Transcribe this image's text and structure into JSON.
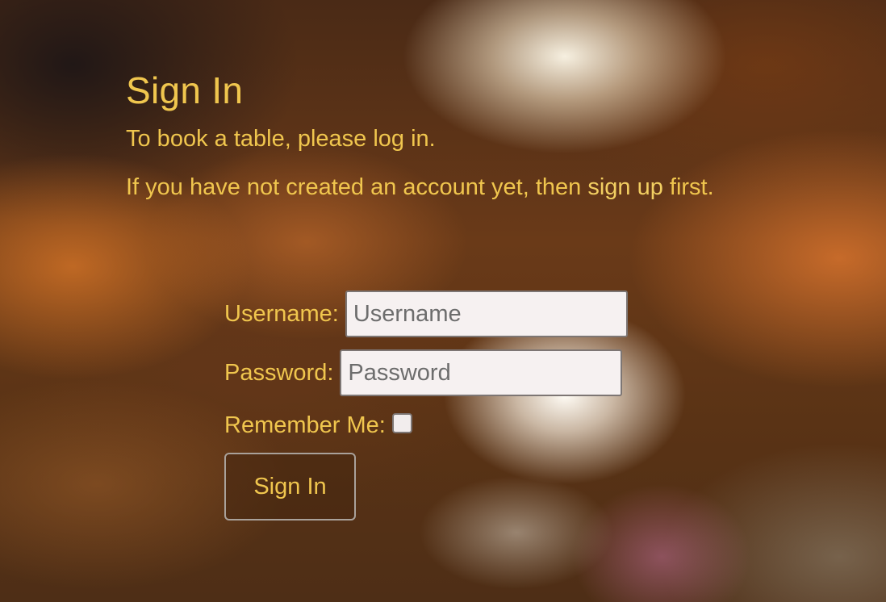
{
  "header": {
    "title": "Sign In",
    "intro": "To book a table, please log in.",
    "signup_prefix": "If you have not created an account yet, then ",
    "signup_link": "sign up",
    "signup_suffix": " first."
  },
  "form": {
    "username_label": "Username:",
    "username_placeholder": "Username",
    "password_label": "Password:",
    "password_placeholder": "Password",
    "remember_label": "Remember Me:",
    "remember_checked": false,
    "submit_label": "Sign In"
  },
  "colors": {
    "accent_text": "#f0c64e"
  }
}
